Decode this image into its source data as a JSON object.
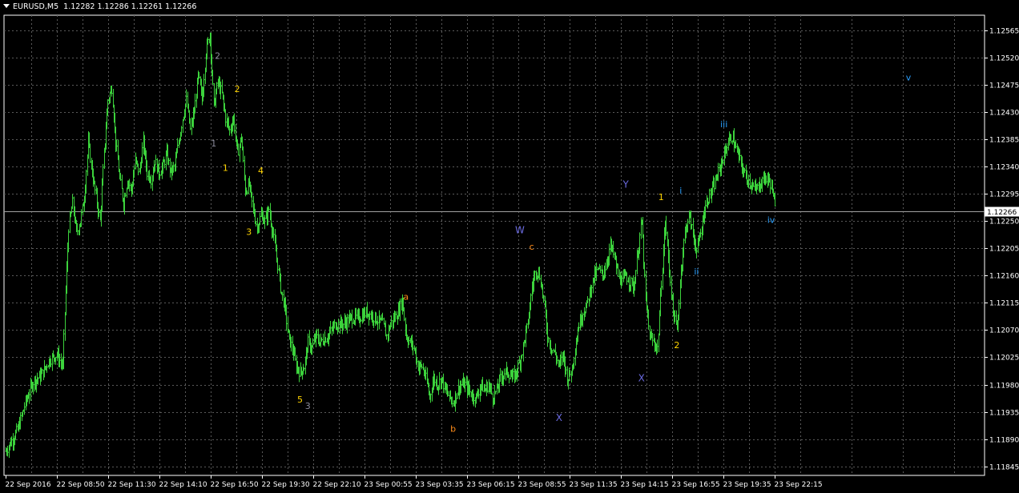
{
  "header": {
    "symbol_timeframe": "EURUSD,M5",
    "ohlc": "1.12282 1.12286 1.12261 1.12266"
  },
  "colors": {
    "background": "#000000",
    "grid": "#5a5a5a",
    "candle": "#3cd23c",
    "axis_text": "#ffffff",
    "price_line": "#a0a0a0",
    "wave_yellow": "#ffd400",
    "wave_grey": "#8a8a9a",
    "wave_orange": "#ff8c1a",
    "wave_purple": "#6a6adf",
    "wave_blue": "#2aa0ff"
  },
  "chart_data": {
    "type": "line",
    "title": "",
    "xlabel": "",
    "ylabel": "",
    "ylim": [
      1.1183,
      1.1259
    ],
    "y_ticks": [
      "1.12565",
      "1.12520",
      "1.12475",
      "1.12430",
      "1.12385",
      "1.12340",
      "1.12295",
      "1.12250",
      "1.12205",
      "1.12160",
      "1.12115",
      "1.12070",
      "1.12025",
      "1.11980",
      "1.11935",
      "1.11890",
      "1.11845"
    ],
    "x_tick_labels": [
      "22 Sep 2016",
      "22 Sep 08:50",
      "22 Sep 11:30",
      "22 Sep 14:10",
      "22 Sep 16:50",
      "22 Sep 19:30",
      "22 Sep 22:10",
      "23 Sep 00:55",
      "23 Sep 03:35",
      "23 Sep 06:15",
      "23 Sep 08:55",
      "23 Sep 11:35",
      "23 Sep 14:15",
      "23 Sep 16:55",
      "23 Sep 19:35",
      "23 Sep 22:15"
    ],
    "current_price": "1.12266",
    "grid": true,
    "series": [
      {
        "points": [
          [
            0,
            1.1187
          ],
          [
            3,
            1.11905
          ],
          [
            5,
            1.1195
          ],
          [
            7,
            1.11985
          ],
          [
            9,
            1.11995
          ],
          [
            11,
            1.1202
          ],
          [
            13,
            1.1203
          ],
          [
            14.5,
            1.1201
          ],
          [
            15,
            1.121
          ],
          [
            16,
            1.1224
          ],
          [
            17,
            1.1228
          ],
          [
            18,
            1.1223
          ],
          [
            19,
            1.1225
          ],
          [
            20,
            1.1229
          ],
          [
            21,
            1.1238
          ],
          [
            22,
            1.1233
          ],
          [
            23,
            1.1229
          ],
          [
            24,
            1.1225
          ],
          [
            25,
            1.1236
          ],
          [
            26,
            1.1245
          ],
          [
            27,
            1.1247
          ],
          [
            28,
            1.1238
          ],
          [
            29,
            1.1232
          ],
          [
            30,
            1.1228
          ],
          [
            31,
            1.1232
          ],
          [
            32,
            1.123
          ],
          [
            33,
            1.1235
          ],
          [
            34,
            1.1233
          ],
          [
            35,
            1.1238
          ],
          [
            36,
            1.1233
          ],
          [
            37,
            1.1232
          ],
          [
            38,
            1.1235
          ],
          [
            39,
            1.1233
          ],
          [
            40,
            1.1234
          ],
          [
            41,
            1.1236
          ],
          [
            42,
            1.1233
          ],
          [
            43,
            1.1234
          ],
          [
            44,
            1.1238
          ],
          [
            45,
            1.1242
          ],
          [
            46,
            1.1245
          ],
          [
            47,
            1.124
          ],
          [
            48,
            1.1243
          ],
          [
            49,
            1.1249
          ],
          [
            50,
            1.1245
          ],
          [
            51,
            1.1253
          ],
          [
            52,
            1.1256
          ],
          [
            53,
            1.1244
          ],
          [
            54,
            1.1248
          ],
          [
            55,
            1.1246
          ],
          [
            56,
            1.1242
          ],
          [
            57,
            1.124
          ],
          [
            58,
            1.1242
          ],
          [
            59,
            1.1236
          ],
          [
            60,
            1.1239
          ],
          [
            61,
            1.123
          ],
          [
            62,
            1.1231
          ],
          [
            63,
            1.1227
          ],
          [
            64,
            1.1224
          ],
          [
            65,
            1.1226
          ],
          [
            66,
            1.1225
          ],
          [
            67,
            1.1227
          ],
          [
            68,
            1.1223
          ],
          [
            69,
            1.1219
          ],
          [
            70,
            1.1214
          ],
          [
            71,
            1.1211
          ],
          [
            72,
            1.1206
          ],
          [
            73,
            1.1204
          ],
          [
            74,
            1.1201
          ],
          [
            75,
            1.12
          ],
          [
            76,
            1.1201
          ],
          [
            77,
            1.1205
          ],
          [
            78,
            1.1204
          ],
          [
            79,
            1.1206
          ],
          [
            80,
            1.1205
          ],
          [
            82,
            1.1206
          ],
          [
            84,
            1.1208
          ],
          [
            86,
            1.1208
          ],
          [
            88,
            1.1209
          ],
          [
            90,
            1.1209
          ],
          [
            92,
            1.121
          ],
          [
            94,
            1.1209
          ],
          [
            96,
            1.1208
          ],
          [
            97,
            1.1206
          ],
          [
            98,
            1.1208
          ],
          [
            100,
            1.121
          ],
          [
            101,
            1.1212
          ],
          [
            102,
            1.1206
          ],
          [
            103,
            1.1205
          ],
          [
            104,
            1.1204
          ],
          [
            105,
            1.1201
          ],
          [
            106,
            1.1201
          ],
          [
            107,
            1.1199
          ],
          [
            108,
            1.1196
          ],
          [
            109,
            1.1199
          ],
          [
            110,
            1.1198
          ],
          [
            111,
            1.1199
          ],
          [
            112,
            1.1197
          ],
          [
            113,
            1.1196
          ],
          [
            114,
            1.1195
          ],
          [
            115,
            1.1197
          ],
          [
            116,
            1.1198
          ],
          [
            117,
            1.1198
          ],
          [
            118,
            1.1197
          ],
          [
            119,
            1.1196
          ],
          [
            120,
            1.1196
          ],
          [
            121,
            1.1198
          ],
          [
            122,
            1.1197
          ],
          [
            123,
            1.1198
          ],
          [
            124,
            1.1196
          ],
          [
            125,
            1.1197
          ],
          [
            126,
            1.1199
          ],
          [
            127,
            1.12
          ],
          [
            128,
            1.12
          ],
          [
            129,
            1.1199
          ],
          [
            130,
            1.12
          ],
          [
            131,
            1.1202
          ],
          [
            132,
            1.1205
          ],
          [
            133,
            1.1208
          ],
          [
            134,
            1.1214
          ],
          [
            135,
            1.1217
          ],
          [
            136,
            1.1216
          ],
          [
            137,
            1.1212
          ],
          [
            138,
            1.1206
          ],
          [
            139,
            1.1204
          ],
          [
            140,
            1.1203
          ],
          [
            141,
            1.1201
          ],
          [
            142,
            1.1203
          ],
          [
            143,
            1.1199
          ],
          [
            144,
            1.12
          ],
          [
            145,
            1.1204
          ],
          [
            146,
            1.1208
          ],
          [
            147,
            1.121
          ],
          [
            148,
            1.1211
          ],
          [
            149,
            1.1214
          ],
          [
            150,
            1.1216
          ],
          [
            151,
            1.1217
          ],
          [
            152,
            1.1216
          ],
          [
            153,
            1.1218
          ],
          [
            154,
            1.1221
          ],
          [
            155,
            1.1219
          ],
          [
            156,
            1.1216
          ],
          [
            157,
            1.1215
          ],
          [
            158,
            1.1216
          ],
          [
            159,
            1.1215
          ],
          [
            160,
            1.1214
          ],
          [
            161,
            1.122
          ],
          [
            162,
            1.1225
          ],
          [
            163,
            1.1212
          ],
          [
            164,
            1.1206
          ],
          [
            165,
            1.1205
          ],
          [
            166,
            1.1204
          ],
          [
            167,
            1.1215
          ],
          [
            168,
            1.1225
          ],
          [
            169,
            1.1217
          ],
          [
            170,
            1.121
          ],
          [
            171,
            1.1207
          ],
          [
            172,
            1.1217
          ],
          [
            173,
            1.1223
          ],
          [
            174,
            1.1226
          ],
          [
            175,
            1.1223
          ],
          [
            176,
            1.122
          ],
          [
            177,
            1.1223
          ],
          [
            178,
            1.1227
          ],
          [
            179,
            1.1229
          ],
          [
            180,
            1.123
          ],
          [
            181,
            1.1232
          ],
          [
            182,
            1.1234
          ],
          [
            183,
            1.1236
          ],
          [
            184,
            1.1238
          ],
          [
            185,
            1.1239
          ],
          [
            186,
            1.1237
          ],
          [
            187,
            1.1235
          ],
          [
            188,
            1.1233
          ],
          [
            189,
            1.1232
          ],
          [
            190,
            1.1231
          ],
          [
            191,
            1.123
          ],
          [
            192,
            1.1231
          ],
          [
            193,
            1.1232
          ],
          [
            194,
            1.1232
          ],
          [
            195,
            1.1231
          ],
          [
            196,
            1.1227
          ]
        ]
      }
    ],
    "wave_labels": [
      {
        "text": "2",
        "x": 54,
        "y": 1.12518,
        "color": "grey"
      },
      {
        "text": "2",
        "x": 59,
        "y": 1.12463,
        "color": "yellow"
      },
      {
        "text": "1",
        "x": 53,
        "y": 1.12373,
        "color": "grey"
      },
      {
        "text": "1",
        "x": 56,
        "y": 1.12333,
        "color": "yellow"
      },
      {
        "text": "4",
        "x": 65,
        "y": 1.12328,
        "color": "yellow"
      },
      {
        "text": "3",
        "x": 62,
        "y": 1.12227,
        "color": "yellow"
      },
      {
        "text": "5",
        "x": 75,
        "y": 1.1195,
        "color": "yellow"
      },
      {
        "text": "3",
        "x": 77,
        "y": 1.1194,
        "color": "grey"
      },
      {
        "text": "a",
        "x": 102,
        "y": 1.1212,
        "color": "orange"
      },
      {
        "text": "b",
        "x": 114,
        "y": 1.11902,
        "color": "orange"
      },
      {
        "text": "c",
        "x": 134,
        "y": 1.12203,
        "color": "orange"
      },
      {
        "text": "W",
        "x": 131,
        "y": 1.1223,
        "color": "purple"
      },
      {
        "text": "X",
        "x": 141,
        "y": 1.1192,
        "color": "purple"
      },
      {
        "text": "Y",
        "x": 158,
        "y": 1.12305,
        "color": "purple"
      },
      {
        "text": "X",
        "x": 162,
        "y": 1.11985,
        "color": "purple"
      },
      {
        "text": "1",
        "x": 167,
        "y": 1.12285,
        "color": "yellow"
      },
      {
        "text": "2",
        "x": 171,
        "y": 1.1204,
        "color": "yellow"
      },
      {
        "text": "i",
        "x": 172,
        "y": 1.12295,
        "color": "blue"
      },
      {
        "text": "ii",
        "x": 176,
        "y": 1.12162,
        "color": "blue"
      },
      {
        "text": "iii",
        "x": 183,
        "y": 1.12405,
        "color": "blue"
      },
      {
        "text": "iv",
        "x": 195,
        "y": 1.12247,
        "color": "blue"
      },
      {
        "text": "v",
        "x": 230,
        "y": 1.12482,
        "color": "blue"
      }
    ]
  }
}
